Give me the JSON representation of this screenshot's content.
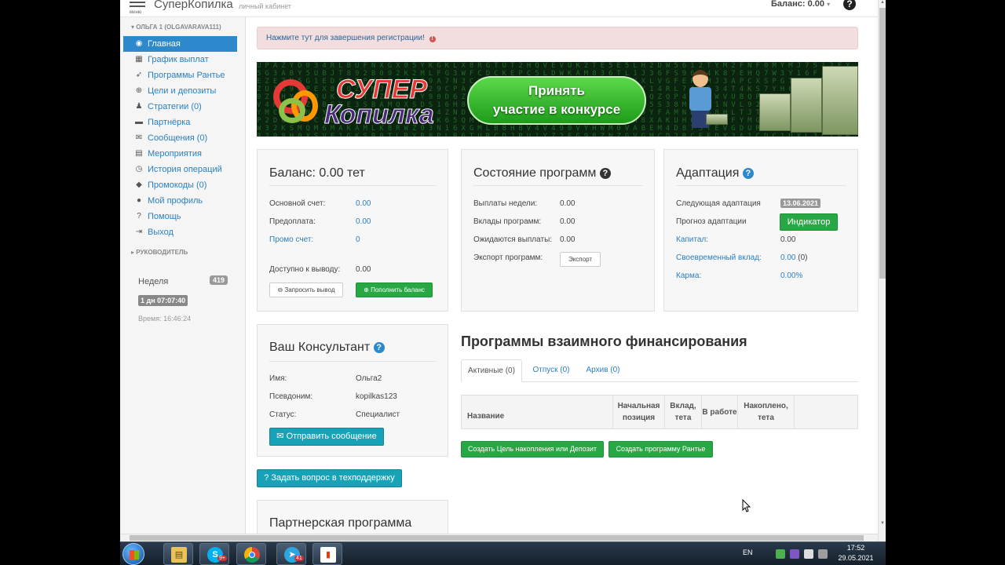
{
  "header": {
    "menu_label": "меню",
    "brand": "СуперКопилка",
    "brand_sub": "личный кабинет",
    "balance": "Баланс: 0.00",
    "balance_caret": "▾",
    "help_glyph": "?"
  },
  "sidebar": {
    "user_head": "ОЛЬГА 1 (OLGAVARAVA111)",
    "items": [
      {
        "label": "Главная",
        "icon": "dashboard-icon",
        "active": true
      },
      {
        "label": "График выплат",
        "icon": "calendar-icon"
      },
      {
        "label": "Программы Рантье",
        "icon": "rocket-icon"
      },
      {
        "label": "Цели и депозиты",
        "icon": "crosshairs-icon"
      },
      {
        "label": "Стратегии (0)",
        "icon": "chess-icon"
      },
      {
        "label": "Партнёрка",
        "icon": "briefcase-icon"
      },
      {
        "label": "Сообщения (0)",
        "icon": "envelope-icon"
      },
      {
        "label": "Мероприятия",
        "icon": "film-icon"
      },
      {
        "label": "История операций",
        "icon": "clock-icon"
      },
      {
        "label": "Промокоды (0)",
        "icon": "tag-icon"
      },
      {
        "label": "Мой профиль",
        "icon": "user-icon"
      },
      {
        "label": "Помощь",
        "icon": "question-circle-icon"
      },
      {
        "label": "Выход",
        "icon": "sign-out-icon"
      }
    ],
    "manager_head": "РУКОВОДИТЕЛЬ",
    "week_label": "Неделя",
    "week_badge": "419",
    "timer": "1 дн 07:07:40",
    "time": "Время: 16:46:24"
  },
  "alert": {
    "text": "Нажмите тут для завершения регистрации!",
    "icon": "!"
  },
  "banner": {
    "logo_top": "СУПЕР",
    "logo_bottom": "Копилка",
    "cta_line1": "Принять",
    "cta_line2": "участие в конкурсе"
  },
  "balance_panel": {
    "title": "Баланс: 0.00 тет",
    "main_label": "Основной счет:",
    "main_value": "0.00",
    "prepay_label": "Предоплата:",
    "prepay_value": "0.00",
    "promo_label": "Промо счет:",
    "promo_value": "0",
    "available_label": "Доступно к выводу:",
    "available_value": "0.00",
    "withdraw_btn": "Запросить вывод",
    "topup_btn": "Пополнить баланс"
  },
  "state_panel": {
    "title": "Состояние программ",
    "rows": [
      {
        "label": "Выплаты недели:",
        "value": "0.00"
      },
      {
        "label": "Вклады программ:",
        "value": "0.00"
      },
      {
        "label": "Ожидаются выплаты:",
        "value": "0.00"
      }
    ],
    "export_label": "Экспорт программ:",
    "export_btn": "Экспорт"
  },
  "adapt_panel": {
    "title": "Адаптация",
    "next_label": "Следующая адаптация",
    "next_date": "13.06.2021",
    "forecast_label": "Прогноз адаптации",
    "indicator_btn": "Индикатор",
    "capital_label": "Капитал:",
    "capital_value": "0.00",
    "timely_label": "Своевременный вклад:",
    "timely_value": "0.00",
    "timely_extra": "(0)",
    "karma_label": "Карма:",
    "karma_value": "0.00%"
  },
  "consultant_panel": {
    "title": "Ваш Консультант",
    "name_label": "Имя:",
    "name_value": "Ольга2",
    "nick_label": "Псевдоним:",
    "nick_value": "kopilkas123",
    "status_label": "Статус:",
    "status_value": "Специалист",
    "send_btn": "Отправить сообщение"
  },
  "support_btn": "Задать вопрос в техподдержку",
  "partner_panel": {
    "title": "Партнерская программа"
  },
  "programs": {
    "title": "Программы взаимного финансирования",
    "tabs": [
      "Активные (0)",
      "Отпуск (0)",
      "Архив (0)"
    ],
    "columns": [
      "Название",
      "Начальная позиция",
      "Вклад, тета",
      "В работе",
      "Накоплено, тета"
    ],
    "create_goal_btn": "Создать Цель накопления или Депозит",
    "create_rentier_btn": "Создать программу Рантье"
  },
  "taskbar": {
    "lang": "EN",
    "time": "17:52",
    "date": "29.05.2021",
    "skype_badge": "9+",
    "telegram_badge": "41"
  },
  "colors": {
    "accent": "#2d89cb",
    "success": "#28a745",
    "info": "#17a2b8",
    "alert_bg": "#f2dede"
  }
}
